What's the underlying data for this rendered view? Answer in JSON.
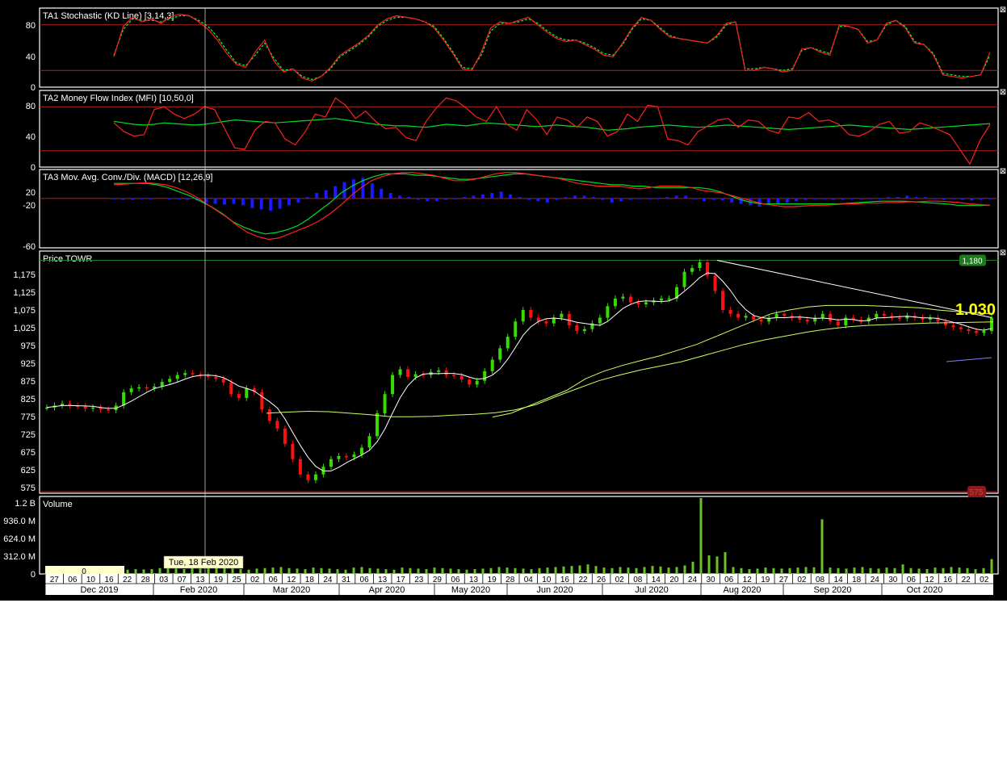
{
  "colors": {
    "background": "#000000",
    "panel_border": "#ffffff",
    "threshold": "#b22222",
    "k_line": "#ff2020",
    "d_line": "#00ff33",
    "mfi_line": "#ff2020",
    "mfi_avg": "#00dd22",
    "macd_line": "#ff2020",
    "macd_signal": "#00dd22",
    "macd_hist": "#1a1aff",
    "candle_up": "#33dd00",
    "candle_down": "#ff1010",
    "ma_short": "#ffffff",
    "ma_long": "#ccff66",
    "volume": "#6bbf2a",
    "price_tag": "#ffff00",
    "resistance_tag": "#1f7a1f",
    "support_tag": "#8b1a1a"
  },
  "panels": {
    "stoch": {
      "title": "TA1 Stochastic (KD Line) [3,14,3]",
      "ticks": [
        "80",
        "40",
        "0"
      ],
      "levels": [
        80,
        20
      ]
    },
    "mfi": {
      "title": "TA2 Money Flow Index (MFI) [10,50,0]",
      "ticks": [
        "80",
        "40",
        "0"
      ],
      "levels": [
        80,
        20
      ]
    },
    "macd": {
      "title": "TA3 Mov. Avg. Conv./Div. (MACD) [12,26,9]",
      "ticks": [
        "20",
        "-20",
        "-60"
      ],
      "levels": [
        0
      ]
    },
    "price": {
      "title": "Price TOWR",
      "ticks": [
        "1,175",
        "1,125",
        "1,075",
        "1,025",
        "975",
        "925",
        "875",
        "825",
        "775",
        "725",
        "675",
        "625",
        "575"
      ],
      "resistance_label": "1,180",
      "support_label": "575",
      "last_price_label": "1.030"
    },
    "volume": {
      "title": "Volume",
      "ticks": [
        "1.2 B",
        "936.0 M",
        "624.0 M",
        "312.0 M",
        "0"
      ],
      "zero_box": "0"
    }
  },
  "crosshair": {
    "label": "Tue, 18 Feb 2020"
  },
  "x_axis": {
    "days": [
      "27",
      "06",
      "10",
      "16",
      "22",
      "28",
      "03",
      "07",
      "13",
      "19",
      "25",
      "02",
      "06",
      "12",
      "18",
      "24",
      "31",
      "06",
      "13",
      "17",
      "23",
      "29",
      "06",
      "13",
      "19",
      "28",
      "04",
      "10",
      "16",
      "22",
      "26",
      "02",
      "08",
      "14",
      "20",
      "24",
      "30",
      "06",
      "12",
      "19",
      "27",
      "02",
      "08",
      "14",
      "18",
      "24",
      "30",
      "06",
      "12",
      "16",
      "22",
      "02"
    ],
    "months": [
      "Dec 2019",
      "Feb 2020",
      "Mar 2020",
      "Apr 2020",
      "May 2020",
      "Jun 2020",
      "Jul 2020",
      "Aug 2020",
      "Sep 2020",
      "Oct 2020"
    ]
  },
  "chart_data": [
    {
      "type": "line",
      "title": "TA1 Stochastic (KD Line) [3,14,3]",
      "ylim": [
        0,
        100
      ],
      "x_range": [
        "2019-12-27",
        "2020-10-02"
      ],
      "series": [
        {
          "values": [
            38,
            78,
            90,
            84,
            88,
            82,
            91,
            94,
            92,
            84,
            74,
            60,
            42,
            28,
            24,
            44,
            60,
            32,
            18,
            22,
            10,
            6,
            12,
            24,
            40,
            48,
            56,
            66,
            80,
            88,
            92,
            90,
            88,
            84,
            76,
            60,
            42,
            22,
            20,
            44,
            76,
            84,
            82,
            86,
            90,
            80,
            70,
            62,
            58,
            60,
            54,
            48,
            40,
            38,
            56,
            76,
            90,
            86,
            74,
            64,
            62,
            60,
            58,
            56,
            66,
            82,
            84,
            20,
            20,
            24,
            22,
            18,
            20,
            48,
            50,
            44,
            40,
            80,
            78,
            74,
            56,
            60,
            82,
            86,
            76,
            56,
            54,
            40,
            14,
            12,
            10,
            12,
            14,
            44
          ]
        },
        {
          "values": [
            40,
            74,
            88,
            86,
            86,
            84,
            88,
            92,
            92,
            86,
            78,
            64,
            46,
            30,
            26,
            40,
            56,
            36,
            20,
            22,
            12,
            8,
            12,
            22,
            38,
            46,
            54,
            64,
            78,
            86,
            90,
            90,
            88,
            84,
            78,
            62,
            44,
            24,
            22,
            40,
            72,
            82,
            82,
            84,
            88,
            82,
            72,
            64,
            60,
            60,
            56,
            50,
            42,
            40,
            54,
            74,
            88,
            86,
            76,
            66,
            62,
            60,
            58,
            56,
            64,
            80,
            84,
            22,
            22,
            24,
            22,
            20,
            22,
            46,
            50,
            46,
            42,
            78,
            78,
            74,
            58,
            60,
            80,
            86,
            78,
            58,
            54,
            42,
            16,
            14,
            12,
            12,
            14,
            40
          ]
        }
      ],
      "levels": [
        80,
        20
      ]
    },
    {
      "type": "line",
      "title": "TA2 Money Flow Index (MFI) [10,50,0]",
      "ylim": [
        0,
        100
      ],
      "x_range": [
        "2019-12-27",
        "2020-10-02"
      ],
      "series": [
        {
          "values": [
            58,
            46,
            40,
            42,
            76,
            80,
            70,
            64,
            70,
            80,
            76,
            50,
            24,
            22,
            48,
            60,
            58,
            36,
            28,
            46,
            70,
            66,
            92,
            82,
            64,
            74,
            60,
            50,
            52,
            38,
            34,
            60,
            78,
            92,
            88,
            78,
            66,
            60,
            80,
            56,
            48,
            76,
            62,
            42,
            66,
            62,
            52,
            66,
            60,
            40,
            46,
            70,
            60,
            82,
            80,
            36,
            34,
            28,
            46,
            54,
            62,
            64,
            52,
            62,
            60,
            48,
            44,
            66,
            64,
            72,
            60,
            62,
            56,
            42,
            40,
            46,
            56,
            60,
            44,
            46,
            58,
            54,
            48,
            42,
            22,
            2,
            34,
            56
          ]
        },
        {
          "values": [
            60,
            58,
            56,
            55,
            56,
            58,
            57,
            56,
            55,
            56,
            58,
            60,
            62,
            61,
            60,
            59,
            58,
            59,
            60,
            61,
            62,
            63,
            64,
            62,
            60,
            58,
            56,
            55,
            54,
            54,
            53,
            52,
            54,
            56,
            55,
            54,
            56,
            58,
            57,
            56,
            55,
            54,
            53,
            54,
            55,
            54,
            53,
            52,
            50,
            48,
            49,
            50,
            52,
            53,
            54,
            55,
            54,
            53,
            52,
            53,
            54,
            55,
            54,
            53,
            52,
            51,
            50,
            49,
            50,
            51,
            52,
            53,
            54,
            55,
            54,
            53,
            52,
            51,
            50,
            49,
            50,
            51,
            52,
            53,
            54,
            55,
            56,
            57
          ]
        }
      ],
      "levels": [
        80,
        20
      ]
    },
    {
      "type": "bar",
      "title": "TA3 Mov. Avg. Conv./Div. (MACD) [12,26,9]",
      "ylim": [
        -70,
        40
      ],
      "x_range": [
        "2019-12-27",
        "2020-10-02"
      ],
      "series": [
        {
          "values": [
            20,
            21,
            22,
            23,
            22,
            20,
            16,
            10,
            2,
            -8,
            -18,
            -28,
            -40,
            -50,
            -56,
            -60,
            -58,
            -52,
            -46,
            -40,
            -32,
            -22,
            -10,
            4,
            16,
            26,
            32,
            36,
            38,
            38,
            36,
            34,
            30,
            26,
            26,
            28,
            32,
            36,
            38,
            38,
            36,
            34,
            32,
            30,
            26,
            22,
            20,
            18,
            18,
            18,
            16,
            14,
            16,
            18,
            18,
            18,
            16,
            12,
            10,
            8,
            4,
            0,
            -4,
            -8,
            -10,
            -12,
            -12,
            -11,
            -10,
            -10,
            -9,
            -8,
            -8,
            -7,
            -7,
            -6,
            -6,
            -5,
            -5,
            -4,
            -4,
            -5,
            -6,
            -8,
            -9,
            -10
          ]
        },
        {
          "values": [
            22,
            22,
            22,
            22,
            20,
            16,
            10,
            4,
            -4,
            -12,
            -22,
            -34,
            -42,
            -48,
            -52,
            -50,
            -46,
            -40,
            -30,
            -18,
            -6,
            8,
            18,
            26,
            32,
            36,
            36,
            36,
            34,
            34,
            32,
            30,
            28,
            28,
            30,
            32,
            34,
            36,
            36,
            34,
            32,
            30,
            28,
            26,
            24,
            22,
            20,
            20,
            18,
            18,
            16,
            16,
            16,
            16,
            16,
            14,
            10,
            4,
            -2,
            -6,
            -8,
            -8,
            -8,
            -8,
            -8,
            -8,
            -8,
            -8,
            -7,
            -6,
            -5,
            -4,
            -4,
            -4,
            -5,
            -6,
            -7,
            -8,
            -10,
            -10,
            -10,
            -10
          ]
        },
        {
          "values": [
            -1,
            -2,
            -2,
            -1,
            0,
            1,
            0,
            -1,
            -2,
            -3,
            -6,
            -8,
            -9,
            -8,
            -10,
            -14,
            -16,
            -18,
            -15,
            -10,
            -6,
            2,
            8,
            12,
            18,
            24,
            28,
            30,
            22,
            14,
            8,
            4,
            2,
            -2,
            -4,
            -4,
            -2,
            0,
            2,
            4,
            6,
            8,
            10,
            6,
            2,
            -2,
            -4,
            -6,
            -2,
            2,
            4,
            4,
            2,
            -2,
            -6,
            -4,
            -2,
            -1,
            -1,
            0,
            2,
            4,
            4,
            -1,
            -4,
            -2,
            -3,
            -6,
            -8,
            -10,
            -12,
            -10,
            -8,
            -6,
            -4,
            -2,
            -1,
            -1,
            -2,
            -2,
            -1,
            0,
            0,
            0,
            2,
            2,
            4,
            2,
            2,
            -1,
            -2,
            -1,
            -2,
            -3,
            -2,
            -1
          ]
        }
      ],
      "levels": [
        0
      ]
    },
    {
      "type": "line",
      "title": "Price TOWR",
      "ylim": [
        575,
        1200
      ],
      "x_range": [
        "2019-12-27",
        "2020-10-02"
      ],
      "series": [
        {
          "values": [
            795,
            800,
            805,
            800,
            798,
            792,
            795,
            790,
            788,
            800,
            835,
            845,
            848,
            845,
            850,
            862,
            870,
            880,
            885,
            882,
            878,
            875,
            870,
            860,
            830,
            820,
            845,
            835,
            790,
            760,
            740,
            700,
            660,
            620,
            605,
            620,
            640,
            660,
            668,
            665,
            672,
            690,
            720,
            780,
            830,
            880,
            895,
            875,
            882,
            880,
            888,
            892,
            880,
            878,
            868,
            855,
            865,
            890,
            920,
            950,
            980,
            1020,
            1050,
            1030,
            1020,
            1015,
            1030,
            1040,
            1010,
            995,
            1000,
            1015,
            1030,
            1060,
            1080,
            1085,
            1070,
            1065,
            1070,
            1075,
            1080,
            1080,
            1110,
            1150,
            1160,
            1175,
            1140,
            1100,
            1050,
            1040,
            1030,
            1035,
            1025,
            1020,
            1030,
            1040,
            1035,
            1030,
            1025,
            1020,
            1030,
            1040,
            1020,
            1010,
            1030,
            1025,
            1020,
            1030,
            1040,
            1035,
            1030,
            1028,
            1035,
            1030,
            1025,
            1030,
            1020,
            1010,
            1005,
            1000,
            995,
            990,
            995,
            1030
          ]
        },
        {
          "values": [
            770,
            780,
            800,
            820,
            840,
            870,
            890,
            905,
            918,
            930,
            945,
            960,
            980,
            1000,
            1020,
            1040,
            1050,
            1058,
            1062,
            1062,
            1062,
            1060,
            1058,
            1056,
            1050,
            1046,
            1042,
            1040
          ]
        },
        {
          "values": [
            780,
            783,
            785,
            784,
            780,
            776,
            771,
            771,
            772,
            775,
            777,
            781,
            789,
            803,
            825,
            845,
            865,
            880,
            893,
            904,
            915,
            930,
            945,
            960,
            972,
            982,
            992,
            1000,
            1006,
            1010,
            1012,
            1014,
            1016,
            1017,
            1018,
            1019
          ]
        }
      ],
      "levels": [
        1180,
        575
      ]
    },
    {
      "type": "bar",
      "title": "Volume",
      "ylim": [
        0,
        1400
      ],
      "x_range": [
        "2019-12-27",
        "2020-10-02"
      ],
      "series": [
        {
          "values": [
            40,
            50,
            60,
            45,
            55,
            70,
            80,
            70,
            90,
            60,
            50,
            60,
            55,
            60,
            80,
            90,
            70,
            60,
            80,
            70,
            100,
            90,
            80,
            70,
            60,
            50,
            70,
            80,
            90,
            100,
            80,
            70,
            60,
            90,
            80,
            70,
            60,
            50,
            90,
            100,
            80,
            70,
            60,
            50,
            90,
            80,
            70,
            60,
            90,
            80,
            70,
            60,
            50,
            60,
            70,
            80,
            100,
            90,
            80,
            70,
            60,
            80,
            90,
            100,
            110,
            120,
            130,
            150,
            120,
            90,
            80,
            100,
            90,
            80,
            100,
            120,
            110,
            90,
            100,
            130,
            200,
            1400,
            320,
            300,
            380,
            100,
            80,
            60,
            70,
            90,
            80,
            70,
            80,
            90,
            100,
            95,
            1000,
            90,
            80,
            70,
            90,
            100,
            80,
            70,
            90,
            80,
            150,
            80,
            70,
            60,
            90,
            80,
            100,
            90,
            80,
            60,
            80,
            250
          ]
        }
      ]
    }
  ]
}
